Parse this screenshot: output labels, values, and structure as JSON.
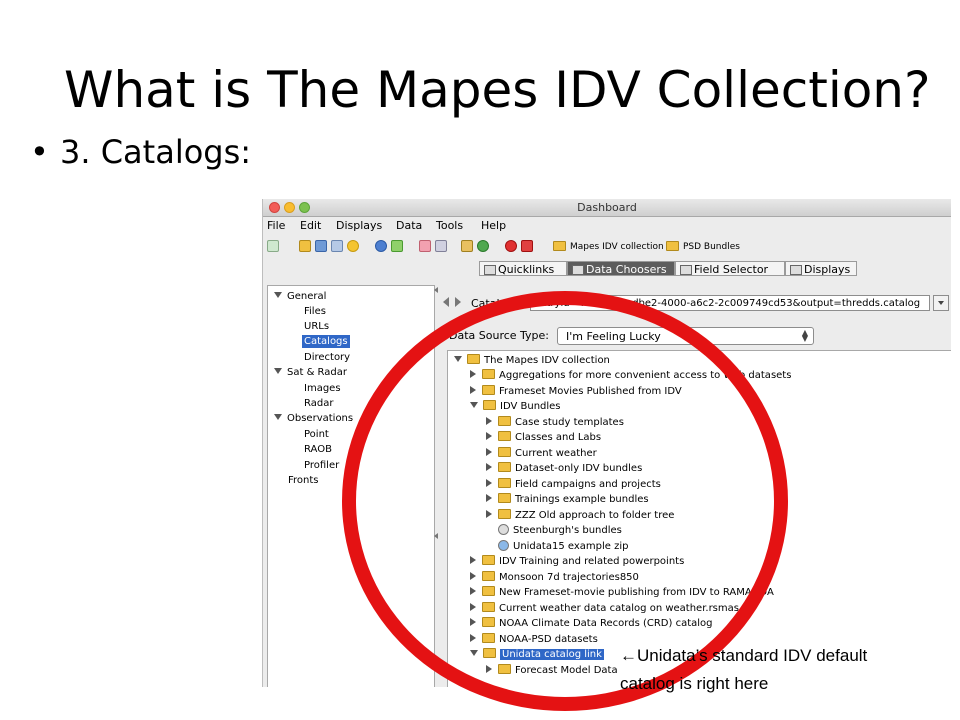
{
  "slide": {
    "title": "What is The Mapes IDV Collection?",
    "bullet": "3. Catalogs:"
  },
  "window": {
    "title": "Dashboard",
    "menus": [
      "File",
      "Edit",
      "Displays",
      "Data",
      "Tools",
      "Help"
    ],
    "toolbar_buttons": [
      "Mapes IDV collection",
      "PSD Bundles"
    ],
    "tabs": [
      "Quicklinks",
      "Data Choosers",
      "Field Selector",
      "Displays"
    ]
  },
  "left_tree": [
    {
      "label": "General",
      "type": "group"
    },
    {
      "label": "Files",
      "type": "item"
    },
    {
      "label": "URLs",
      "type": "item"
    },
    {
      "label": "Catalogs",
      "type": "item",
      "selected": true
    },
    {
      "label": "Directory",
      "type": "item"
    },
    {
      "label": "Sat & Radar",
      "type": "group"
    },
    {
      "label": "Images",
      "type": "item"
    },
    {
      "label": "Radar",
      "type": "item"
    },
    {
      "label": "Observations",
      "type": "group"
    },
    {
      "label": "Point",
      "type": "item"
    },
    {
      "label": "RAOB",
      "type": "item"
    },
    {
      "label": "Profiler",
      "type": "item"
    },
    {
      "label": "Fronts",
      "type": "root"
    }
  ],
  "catalog": {
    "label": "Catalogs:",
    "url": "entryid=45e3b50b-dbe2-4000-a6c2-2c009749cd53&output=thredds.catalog"
  },
  "data_source": {
    "label": "Data Source Type:",
    "value": "I'm Feeling Lucky"
  },
  "catalog_tree": [
    {
      "label": "The Mapes IDV collection",
      "level": 0,
      "state": "open",
      "icon": "folder-icon"
    },
    {
      "label": "Aggregations for more convenient access to Web datasets",
      "level": 1,
      "state": "closed",
      "icon": "folder-icon"
    },
    {
      "label": "Frameset Movies Published from IDV",
      "level": 1,
      "state": "closed",
      "icon": "folder-icon"
    },
    {
      "label": "IDV Bundles",
      "level": 1,
      "state": "open",
      "icon": "folder-icon"
    },
    {
      "label": "Case study templates",
      "level": 2,
      "state": "closed",
      "icon": "folder-icon"
    },
    {
      "label": "Classes and Labs",
      "level": 2,
      "state": "closed",
      "icon": "folder-icon"
    },
    {
      "label": "Current weather",
      "level": 2,
      "state": "closed",
      "icon": "folder-icon"
    },
    {
      "label": "Dataset-only IDV bundles",
      "level": 2,
      "state": "closed",
      "icon": "folder-icon"
    },
    {
      "label": "Field campaigns and projects",
      "level": 2,
      "state": "closed",
      "icon": "folder-icon"
    },
    {
      "label": "Trainings example bundles",
      "level": 2,
      "state": "closed",
      "icon": "folder-icon"
    },
    {
      "label": "ZZZ Old approach to folder tree",
      "level": 2,
      "state": "closed",
      "icon": "folder-icon"
    },
    {
      "label": "Steenburgh's bundles",
      "level": 2,
      "state": "leaf",
      "icon": "link-icon"
    },
    {
      "label": "Unidata15 example zip",
      "level": 2,
      "state": "leaf",
      "icon": "globe-icon"
    },
    {
      "label": "IDV Training and related powerpoints",
      "level": 1,
      "state": "closed",
      "icon": "folder-icon"
    },
    {
      "label": "Monsoon 7d trajectories850",
      "level": 1,
      "state": "closed",
      "icon": "folder-icon"
    },
    {
      "label": "New Frameset-movie publishing from IDV to RAMADDA",
      "level": 1,
      "state": "closed",
      "icon": "folder-icon"
    },
    {
      "label": "Current weather data catalog on weather.rsmas",
      "level": 1,
      "state": "closed",
      "icon": "folder-icon"
    },
    {
      "label": "NOAA Climate Data Records (CRD) catalog",
      "level": 1,
      "state": "closed",
      "icon": "folder-icon"
    },
    {
      "label": "NOAA-PSD datasets",
      "level": 1,
      "state": "closed",
      "icon": "folder-icon"
    },
    {
      "label": "Unidata catalog link",
      "level": 1,
      "state": "open",
      "icon": "folder-icon",
      "selected": true
    },
    {
      "label": "Forecast Model Data",
      "level": 2,
      "state": "closed",
      "icon": "folder-icon"
    }
  ],
  "annotation": {
    "arrow": "←",
    "line1": "Unidata’s standard IDV default",
    "line2": "catalog is right here"
  },
  "colors": {
    "circle": "#e41213",
    "selection": "#2f67c7",
    "folder": "#f0c040"
  }
}
